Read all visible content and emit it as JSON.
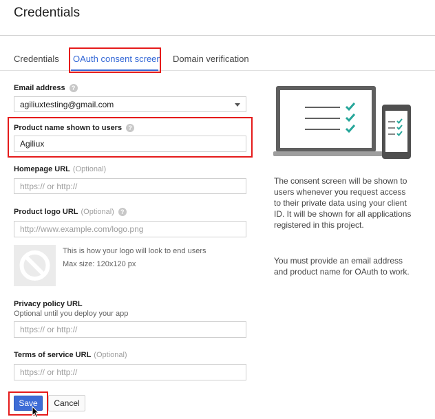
{
  "page": {
    "title": "Credentials"
  },
  "tabs": [
    {
      "label": "Credentials"
    },
    {
      "label": "OAuth consent screen",
      "active": true
    },
    {
      "label": "Domain verification"
    }
  ],
  "form": {
    "email": {
      "label": "Email address",
      "value": "agiliuxtesting@gmail.com"
    },
    "product_name": {
      "label": "Product name shown to users",
      "value": "Agiliux"
    },
    "homepage": {
      "label": "Homepage URL",
      "optional": "(Optional)",
      "placeholder": "https:// or http://"
    },
    "logo_url": {
      "label": "Product logo URL",
      "optional": "(Optional)",
      "placeholder": "http://www.example.com/logo.png"
    },
    "logo_preview": {
      "text": "This is how your logo will look to end users",
      "max_size": "Max size: 120x120 px"
    },
    "privacy": {
      "label": "Privacy policy URL",
      "hint": "Optional until you deploy your app",
      "placeholder": "https:// or http://"
    },
    "terms": {
      "label": "Terms of service URL",
      "optional": "(Optional)",
      "placeholder": "https:// or http://"
    }
  },
  "info": {
    "paragraph1": "The consent screen will be shown to users whenever you request access to their private data using your client ID. It will be shown for all applications registered in this project.",
    "paragraph2": "You must provide an email address and product name for OAuth to work."
  },
  "actions": {
    "save_label": "Save",
    "cancel_label": "Cancel"
  },
  "colors": {
    "accent": "#3367d6",
    "highlight": "#e51a1a",
    "check": "#26a69a"
  },
  "icons": {
    "help": "help-circle-icon",
    "select": "chevron-down-icon",
    "logo": "no-image-icon",
    "cursor": "mouse-pointer-icon"
  }
}
